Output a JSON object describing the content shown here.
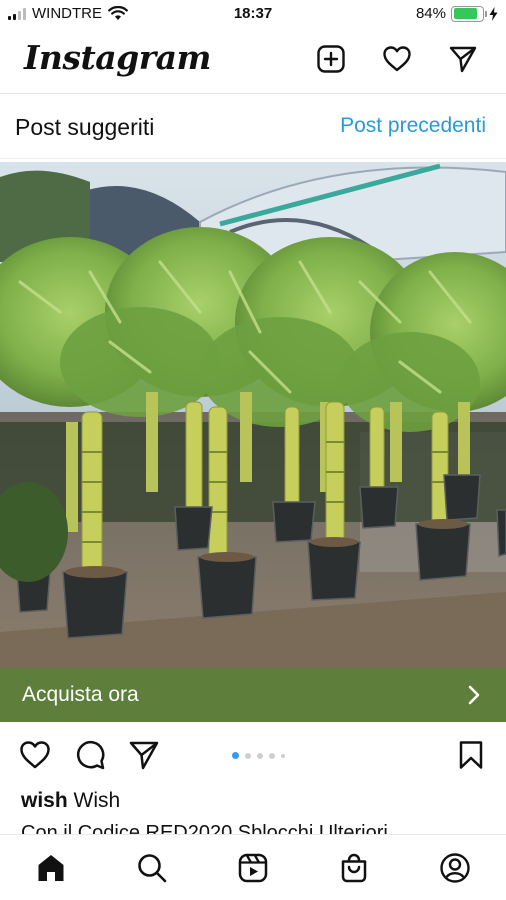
{
  "status_bar": {
    "carrier": "WINDTRE",
    "time": "18:37",
    "battery": "84%",
    "battery_level": 0.84,
    "signal_bars_filled": 2,
    "icons": [
      "signal-icon",
      "wifi-icon",
      "battery-icon",
      "charging-icon"
    ]
  },
  "header": {
    "logo": "Instagram",
    "icons": [
      "new-post-icon",
      "heart-icon",
      "direct-icon"
    ]
  },
  "suggested": {
    "title": "Post suggeriti",
    "link": "Post precedenti",
    "link_color": "#2a9ad7"
  },
  "post": {
    "image_description_icon": "photo",
    "cta": {
      "label": "Acquista ora",
      "background": "#5e7f3b"
    },
    "actions": [
      "like-icon",
      "comment-icon",
      "share-icon",
      "save-icon"
    ],
    "carousel": {
      "count": 5,
      "active_index": 0,
      "active_color": "#3897f0"
    },
    "username": "wish",
    "display_name": "Wish",
    "caption": "Con il Codice RED2020 Sblocchi Ulteriori"
  },
  "bottom_nav": {
    "items": [
      "home-icon",
      "search-icon",
      "reels-icon",
      "shop-icon",
      "profile-icon"
    ],
    "active": "home-icon"
  }
}
